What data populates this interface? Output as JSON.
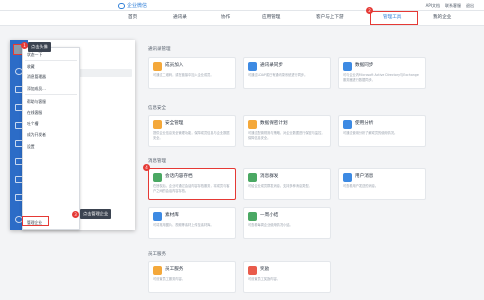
{
  "topbar": {
    "logo_text": "企业微信",
    "links": [
      "API文档",
      "联系客服",
      "退出"
    ]
  },
  "nav": {
    "items": [
      "首页",
      "通讯录",
      "协作",
      "应用管理",
      "客户与上下游",
      "管理工具",
      "我的企业"
    ],
    "active_index": 5,
    "active_badge": "2"
  },
  "sections": [
    {
      "title": "通讯录管理",
      "cards": [
        {
          "title": "成员加入",
          "desc": "可通过二维码，或在链接中加入企业成员。",
          "color": "#f4a83a"
        },
        {
          "title": "通讯录同步",
          "desc": "可通过LDAP或已有通讯录系统进行同步。",
          "color": "#3d8ae3"
        },
        {
          "title": "数据同步",
          "desc": "可与企业内Microsoft Active Directory与Exchange服务器进行数据同步。",
          "color": "#3d8ae3"
        }
      ]
    },
    {
      "title": "信息安全",
      "cards": [
        {
          "title": "安全管理",
          "desc": "提供企业信息安全管理功能，保障成员信息与企业数据安全。",
          "color": "#f4a83a"
        },
        {
          "title": "数据保密计划",
          "desc": "可通过配置规则与策略，对企业数据进行保密与监控，保障信息安全。",
          "color": "#f4a83a"
        },
        {
          "title": "使用分析",
          "desc": "可通过使用分析了解成员的使用情况。",
          "color": "#3d8ae3"
        }
      ]
    },
    {
      "title": "消息管理",
      "cards": [
        {
          "title": "会话内容存档",
          "desc": "在授权后，企业可通过会话内容存档服务，将成员与客户之间的会话内容存档。",
          "color": "#4aa863"
        },
        {
          "title": "消息群发",
          "desc": "可给企业成员群发消息，支持多种消息类型。",
          "color": "#4aa863"
        },
        {
          "title": "用户消息",
          "desc": "可查看用户发送的消息。",
          "color": "#3d8ae3"
        },
        {
          "title": "素材库",
          "desc": "可将常用图片、视频等素材上传至素材库。",
          "color": "#3d8ae3"
        },
        {
          "title": "一周小结",
          "desc": "可查看每周企业使用情况小结。",
          "color": "#4aa863"
        }
      ]
    },
    {
      "title": "员工服务",
      "cards": [
        {
          "title": "员工服务",
          "desc": "可设置员工服务内容。",
          "color": "#f4a83a"
        },
        {
          "title": "奖励",
          "desc": "可设置员工奖励内容。",
          "color": "#e95b4b"
        }
      ]
    }
  ],
  "wechat": {
    "search_placeholder": "搜索工作联系人",
    "tip_avatar": "点击头像",
    "tip_manage": "点击管理企业",
    "badge1": "1",
    "badge3": "3",
    "badge4": "4",
    "menu": [
      "状态一下",
      "收藏",
      "消息管理器",
      "添加成员...",
      "帮助与客服",
      "在线客服",
      "吐个槽",
      "成为开发者",
      "设置",
      "管理企业"
    ]
  }
}
